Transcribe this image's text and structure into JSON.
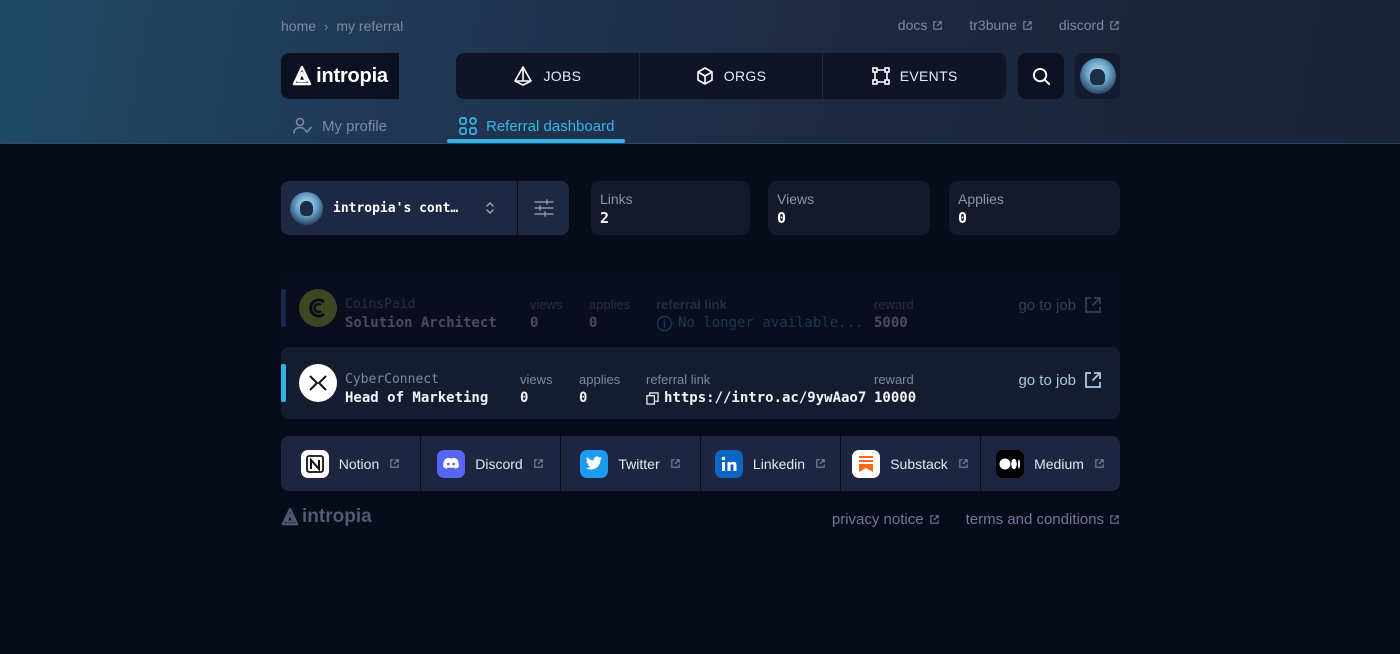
{
  "breadcrumb": {
    "home": "home",
    "current": "my referral"
  },
  "top_links": [
    {
      "label": "docs"
    },
    {
      "label": "tr3bune"
    },
    {
      "label": "discord"
    }
  ],
  "brand": {
    "name": "intropia"
  },
  "nav": {
    "jobs": "JOBS",
    "orgs": "ORGS",
    "events": "EVENTS"
  },
  "tabs": {
    "profile": "My profile",
    "referral": "Referral dashboard"
  },
  "selector": {
    "name": "intropia's cont…"
  },
  "stats": {
    "links": {
      "label": "Links",
      "value": "2"
    },
    "views": {
      "label": "Views",
      "value": "0"
    },
    "applies": {
      "label": "Applies",
      "value": "0"
    }
  },
  "jobs": [
    {
      "org": "CoinsPaid",
      "title": "Solution Architect",
      "views_label": "views",
      "views": "0",
      "applies_label": "applies",
      "applies": "0",
      "link_label": "referral link",
      "link": "No longer available...",
      "reward_label": "reward",
      "reward": "5000",
      "goto": "go to job"
    },
    {
      "org": "CyberConnect",
      "title": "Head of Marketing",
      "views_label": "views",
      "views": "0",
      "applies_label": "applies",
      "applies": "0",
      "link_label": "referral link",
      "link": "https://intro.ac/9ywAao7",
      "reward_label": "reward",
      "reward": "10000",
      "goto": "go to job"
    }
  ],
  "socials": [
    {
      "label": "Notion"
    },
    {
      "label": "Discord"
    },
    {
      "label": "Twitter"
    },
    {
      "label": "Linkedin"
    },
    {
      "label": "Substack"
    },
    {
      "label": "Medium"
    }
  ],
  "footer": {
    "brand": "intropia",
    "privacy": "privacy notice",
    "terms": "terms and conditions"
  },
  "colors": {
    "accent": "#33b4e8",
    "background": "#070b1a"
  }
}
